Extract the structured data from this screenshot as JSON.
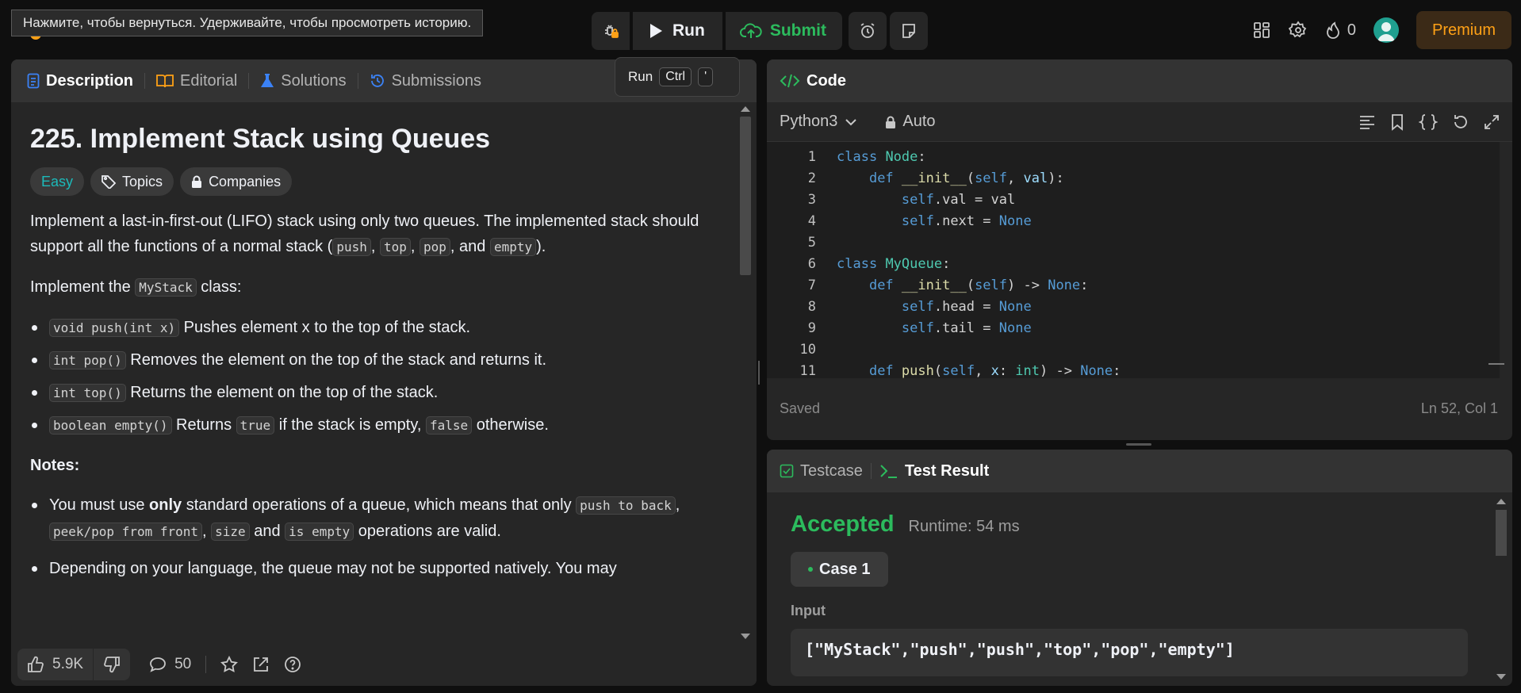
{
  "browser": {
    "back_tooltip": "Нажмите, чтобы вернуться. Удерживайте, чтобы просмотреть историю."
  },
  "toolbar": {
    "run_label": "Run",
    "submit_label": "Submit",
    "streak_count": "0",
    "premium_label": "Premium"
  },
  "run_tooltip": {
    "label": "Run",
    "key1": "Ctrl",
    "key2": "'"
  },
  "left_tabs": {
    "description": "Description",
    "editorial": "Editorial",
    "solutions": "Solutions",
    "submissions": "Submissions"
  },
  "problem": {
    "title": "225. Implement Stack using Queues",
    "difficulty": "Easy",
    "topics_label": "Topics",
    "companies_label": "Companies",
    "p1_a": "Implement a last-in-first-out (LIFO) stack using only two queues. The implemented stack should support all the functions of a normal stack (",
    "p1_push": "push",
    "p1_sep1": ", ",
    "p1_top": "top",
    "p1_sep2": ", ",
    "p1_pop": "pop",
    "p1_and": ", and ",
    "p1_empty": "empty",
    "p1_end": ").",
    "p2_a": "Implement the ",
    "p2_code": "MyStack",
    "p2_b": " class:",
    "m1_code": "void push(int x)",
    "m1_text": " Pushes element x to the top of the stack.",
    "m2_code": "int pop()",
    "m2_text": " Removes the element on the top of the stack and returns it.",
    "m3_code": "int top()",
    "m3_text": " Returns the element on the top of the stack.",
    "m4_code": "boolean empty()",
    "m4_text": " Returns ",
    "m4_true": "true",
    "m4_mid": " if the stack is empty, ",
    "m4_false": "false",
    "m4_end": " otherwise.",
    "notes_title": "Notes:",
    "n1_a": "You must use ",
    "n1_bold": "only",
    "n1_b": " standard operations of a queue, which means that only ",
    "n1_c1": "push to back",
    "n1_s1": ", ",
    "n1_c2": "peek/pop from front",
    "n1_s2": ", ",
    "n1_c3": "size",
    "n1_and": " and ",
    "n1_c4": "is empty",
    "n1_end": " operations are valid.",
    "n2": "Depending on your language, the queue may not be supported natively. You may"
  },
  "bottom_bar": {
    "likes": "5.9K",
    "comments": "50"
  },
  "code_panel": {
    "title": "Code",
    "language": "Python3",
    "mode": "Auto",
    "status": "Saved",
    "cursor": "Ln 52, Col 1",
    "lines": [
      {
        "n": "1"
      },
      {
        "n": "2"
      },
      {
        "n": "3"
      },
      {
        "n": "4"
      },
      {
        "n": "5"
      },
      {
        "n": "6"
      },
      {
        "n": "7"
      },
      {
        "n": "8"
      },
      {
        "n": "9"
      },
      {
        "n": "10"
      },
      {
        "n": "11"
      }
    ],
    "tokens": {
      "class": "class",
      "node": "Node",
      "colon": ":",
      "def": "def",
      "init": "__init__",
      "self": "self",
      "val": "val",
      "none": "None",
      "myqueue": "MyQueue",
      "push": "push",
      "x": "x",
      "int": "int"
    }
  },
  "test_panel": {
    "testcase_tab": "Testcase",
    "result_tab": "Test Result",
    "verdict": "Accepted",
    "runtime": "Runtime: 54 ms",
    "case_label": "Case 1",
    "input_label": "Input",
    "input_value": "[\"MyStack\",\"push\",\"push\",\"top\",\"pop\",\"empty\"]"
  },
  "colors": {
    "accent": "#ffa116",
    "success": "#2cbb5d",
    "easy": "#1cbaba",
    "panel": "#262626",
    "background": "#0f0f0f"
  }
}
